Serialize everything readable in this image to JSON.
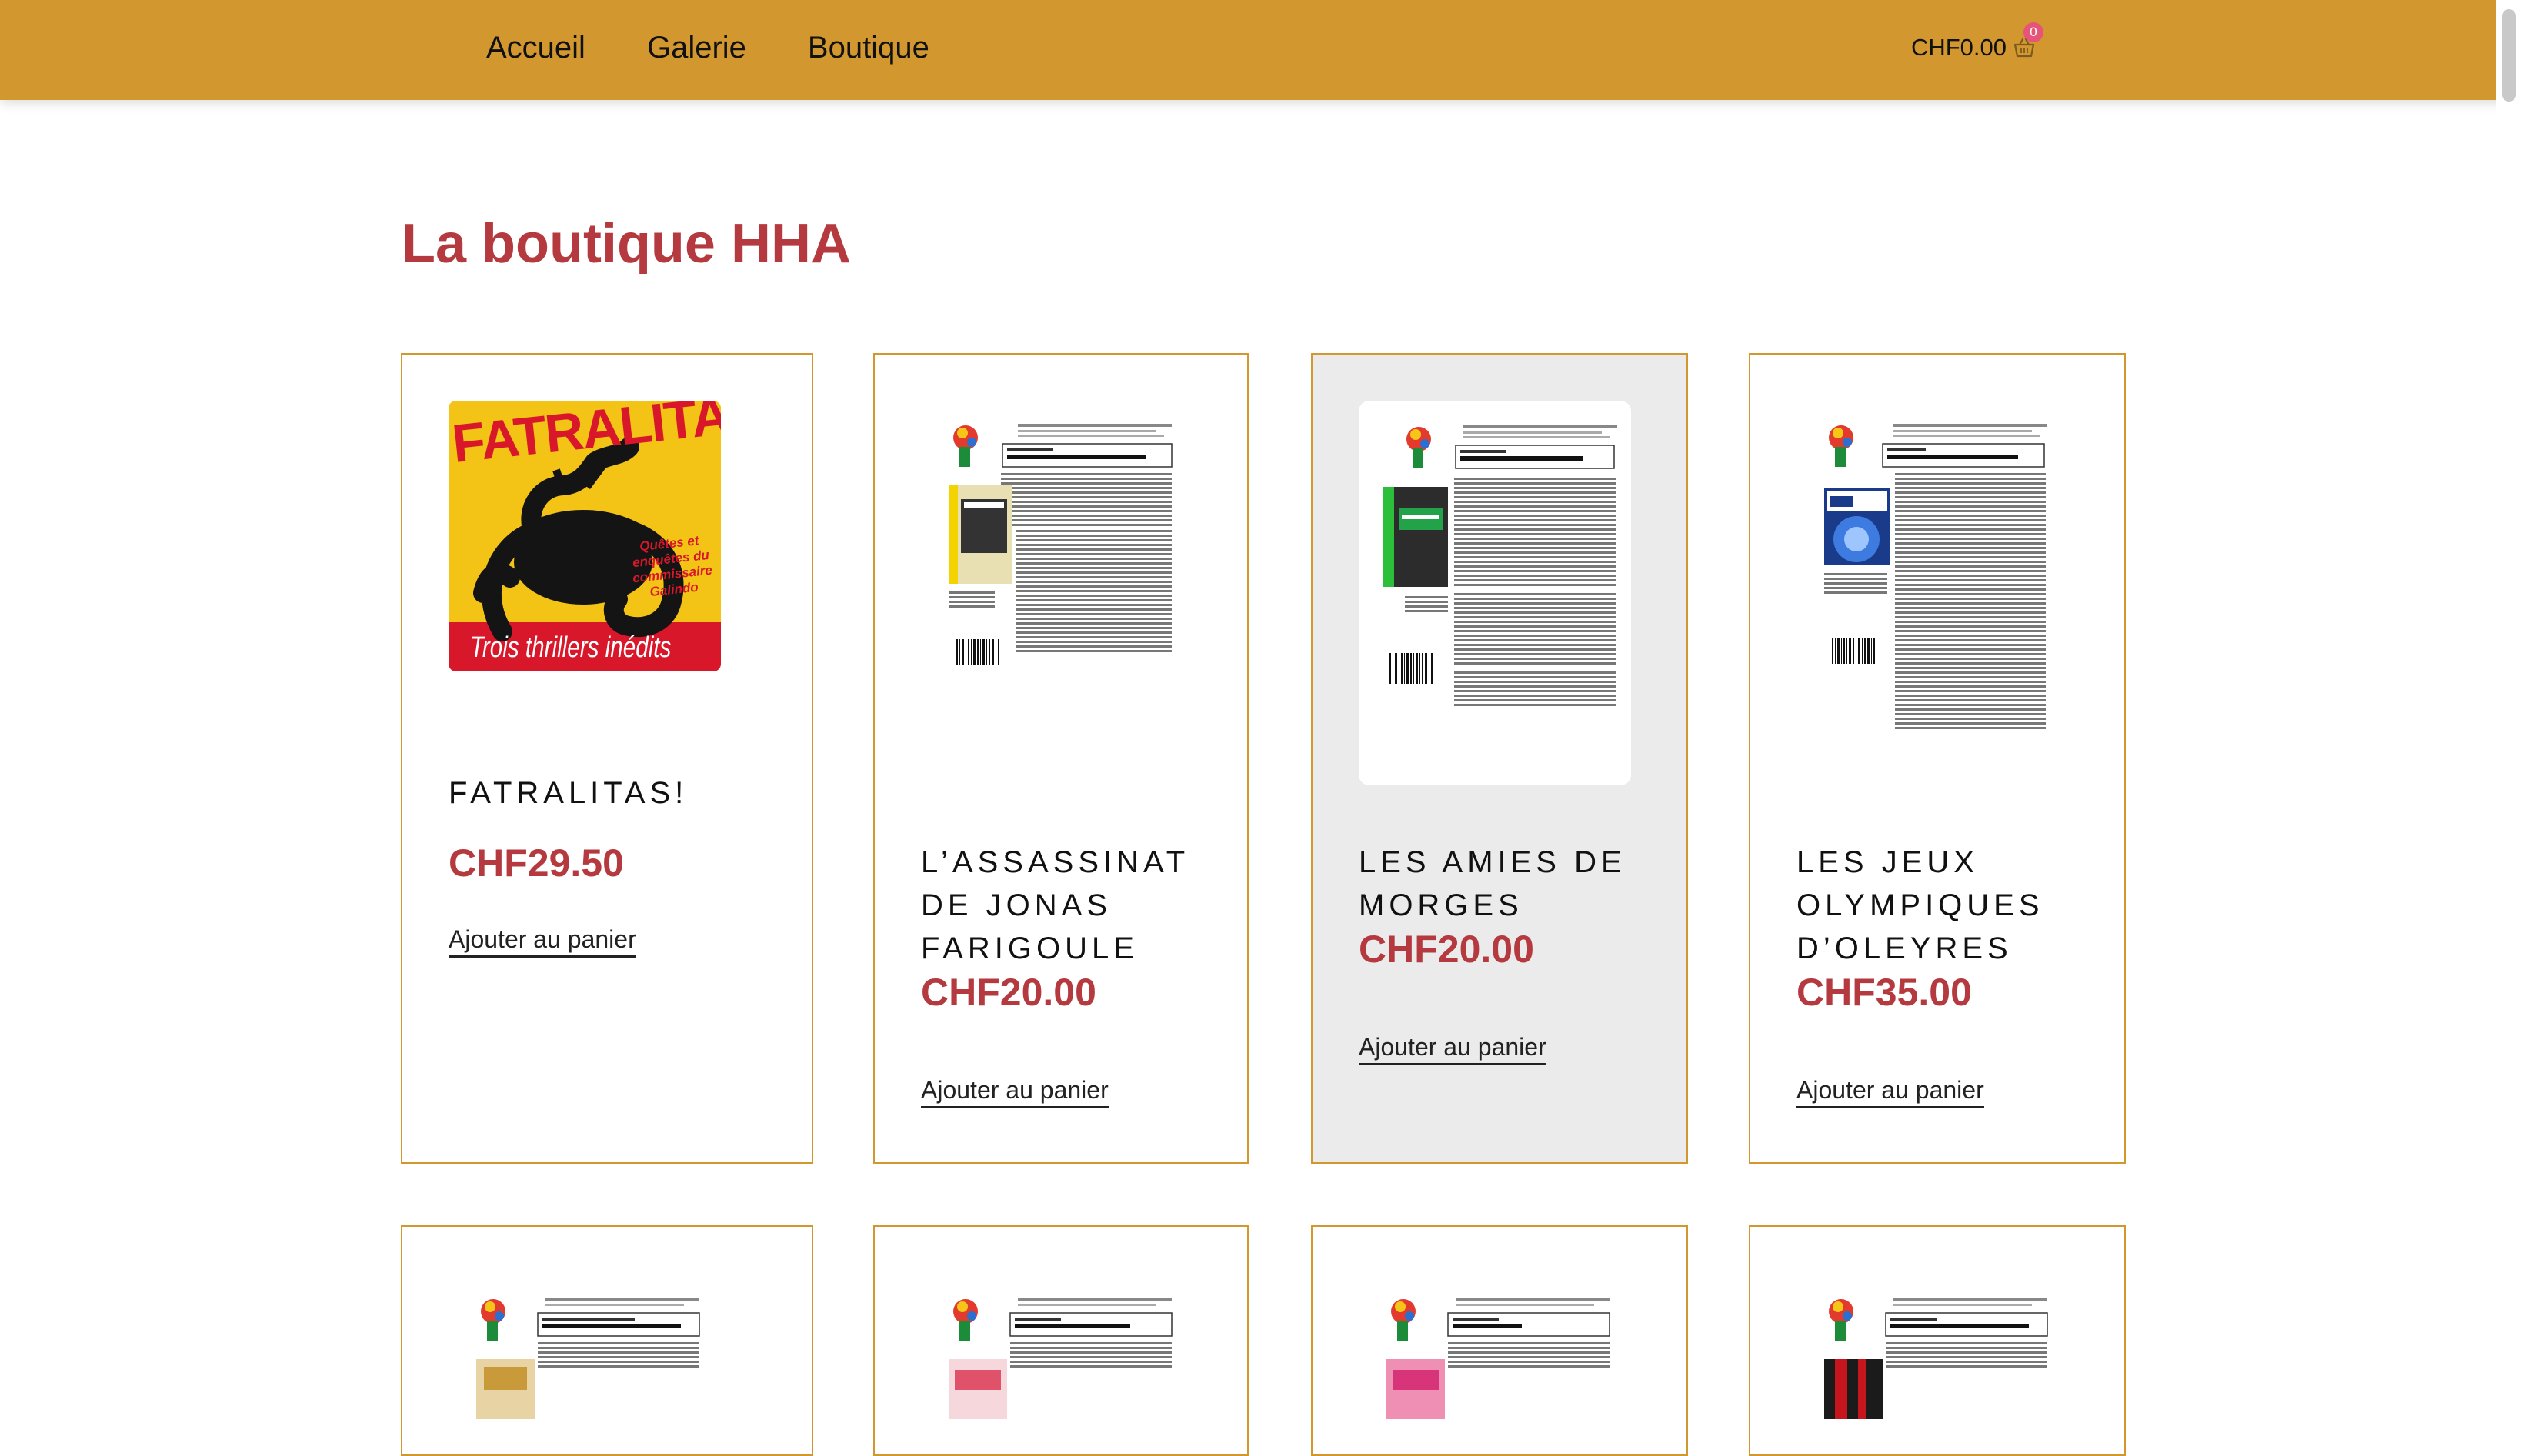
{
  "nav": {
    "items": [
      {
        "label": "Accueil"
      },
      {
        "label": "Galerie"
      },
      {
        "label": "Boutique"
      }
    ]
  },
  "cart": {
    "amount": "CHF0.00",
    "count": "0"
  },
  "page": {
    "title": "La boutique HHA"
  },
  "products": [
    {
      "name": "FATRALITAS!",
      "price": "CHF29.50",
      "button": "Ajouter au panier",
      "cover": {
        "title": "FATRALITAS!",
        "subtitle": "Quêtes et enquêtes du commissaire Galindo",
        "banner": "Trois thrillers inédits"
      }
    },
    {
      "name": "L’ASSASSINAT DE JONAS FARIGOULE",
      "price": "CHF20.00",
      "button": "Ajouter au panier"
    },
    {
      "name": "LES AMIES DE MORGES",
      "price": "CHF20.00",
      "button": "Ajouter au panier"
    },
    {
      "name": "LES JEUX OLYMPIQUES D’OLEYRES",
      "price": "CHF35.00",
      "button": "Ajouter au panier"
    }
  ],
  "colors": {
    "topbar": "#d39730",
    "accent": "#b53a3f",
    "card_border": "#d39730",
    "hover_bg": "#ebebeb",
    "badge": "#e5557a"
  },
  "icons": {
    "cart": "basket-icon"
  }
}
